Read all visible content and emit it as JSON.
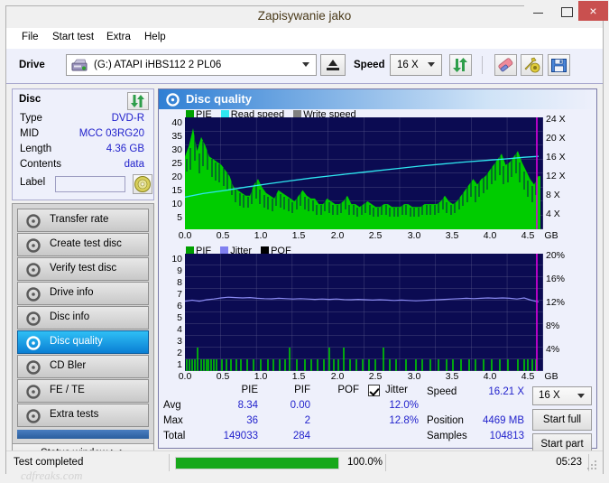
{
  "window": {
    "title": "Zapisywanie jako",
    "buttons": {
      "minimize": "minimize-icon",
      "maximize": "maximize-icon",
      "close": "×"
    }
  },
  "menu": {
    "items": [
      "File",
      "Start test",
      "Extra",
      "Help"
    ]
  },
  "toolbar": {
    "drive_label": "Drive",
    "drive_value": "(G:)  ATAPI iHBS112  2 PL06",
    "eject_title": "eject",
    "speed_label": "Speed",
    "speed_value": "16 X",
    "icons": [
      "refresh-icon",
      "eraser-icon",
      "tools-icon",
      "save-icon"
    ]
  },
  "disc": {
    "header": "Disc",
    "rows": [
      {
        "key": "Type",
        "value": "DVD-R"
      },
      {
        "key": "MID",
        "value": "MCC 03RG20"
      },
      {
        "key": "Length",
        "value": "4.36 GB"
      },
      {
        "key": "Contents",
        "value": "data"
      }
    ],
    "label_key": "Label",
    "label_value": ""
  },
  "nav": {
    "items": [
      "Transfer rate",
      "Create test disc",
      "Verify test disc",
      "Drive info",
      "Disc info",
      "Disc quality",
      "CD Bler",
      "FE / TE",
      "Extra tests"
    ],
    "selected_index": 5,
    "status_window": "Status window > >"
  },
  "main": {
    "title": "Disc quality"
  },
  "chart_data": [
    {
      "type": "area",
      "name": "pie-chart",
      "title": "Disc quality",
      "legend": [
        {
          "label": "PIE",
          "color": "#00a000"
        },
        {
          "label": "Read speed",
          "color": "#2ee6f0"
        },
        {
          "label": "Write speed",
          "color": "#808080"
        }
      ],
      "legend_position": "top-left",
      "grid": true,
      "xlabel": "GB",
      "xticks": [
        "0.0",
        "0.5",
        "1.0",
        "1.5",
        "2.0",
        "2.5",
        "3.0",
        "3.5",
        "4.0",
        "4.5"
      ],
      "xlim": [
        0,
        4.7
      ],
      "ylabel_left": "PIE",
      "yticks_left": [
        "40",
        "35",
        "30",
        "25",
        "20",
        "15",
        "10",
        "5"
      ],
      "ylim_left": [
        0,
        40
      ],
      "ylabel_right": "Speed",
      "yticks_right": [
        "24 X",
        "20 X",
        "16 X",
        "12 X",
        "8 X",
        "4 X"
      ],
      "ylim_right": [
        0,
        24
      ],
      "series": [
        {
          "name": "PIE",
          "color": "#00cc00",
          "x": [
            0.0,
            0.05,
            0.1,
            0.15,
            0.2,
            0.25,
            0.3,
            0.35,
            0.4,
            0.45,
            0.5,
            0.55,
            0.6,
            0.65,
            0.7,
            0.75,
            0.8,
            0.85,
            0.9,
            0.95,
            1.0,
            1.05,
            1.1,
            1.15,
            1.2,
            1.25,
            1.3,
            1.35,
            1.4,
            1.45,
            1.5,
            1.55,
            1.6,
            1.65,
            1.7,
            1.75,
            1.8,
            1.85,
            1.9,
            1.95,
            2.0,
            2.05,
            2.1,
            2.15,
            2.2,
            2.25,
            2.3,
            2.35,
            2.4,
            2.45,
            2.5,
            2.55,
            2.6,
            2.65,
            2.7,
            2.75,
            2.8,
            2.85,
            2.9,
            2.95,
            3.0,
            3.05,
            3.1,
            3.15,
            3.2,
            3.25,
            3.3,
            3.35,
            3.4,
            3.45,
            3.5,
            3.55,
            3.6,
            3.65,
            3.7,
            3.75,
            3.8,
            3.85,
            3.9,
            3.95,
            4.0,
            4.05,
            4.1,
            4.15,
            4.2,
            4.25,
            4.3,
            4.35,
            4.4
          ],
          "values": [
            26,
            30,
            36,
            28,
            33,
            30,
            26,
            25,
            24,
            23,
            21,
            19,
            15,
            14,
            13,
            12,
            12,
            16,
            18,
            15,
            13,
            12,
            11,
            14,
            13,
            12,
            11,
            10,
            11,
            13,
            11,
            10,
            10,
            9,
            9,
            11,
            10,
            9,
            9,
            10,
            11,
            9,
            9,
            8,
            9,
            10,
            9,
            8,
            8,
            9,
            9,
            8,
            8,
            8,
            9,
            9,
            8,
            8,
            8,
            9,
            9,
            9,
            9,
            10,
            11,
            10,
            9,
            10,
            11,
            12,
            13,
            14,
            13,
            14,
            15,
            16,
            17,
            18,
            19,
            21,
            20,
            22,
            23,
            24,
            22,
            20,
            18,
            17,
            19
          ]
        },
        {
          "name": "Read speed",
          "color": "#2ee6f0",
          "x": [
            0.0,
            0.5,
            1.0,
            1.5,
            2.0,
            2.5,
            3.0,
            3.5,
            4.0,
            4.45
          ],
          "values": [
            6.9,
            8.4,
            9.6,
            10.8,
            11.8,
            12.9,
            13.9,
            14.9,
            15.7,
            16.2
          ],
          "axis": "right",
          "unit": "X"
        }
      ],
      "marker_line": {
        "x": 4.45,
        "color": "#e000e0"
      }
    },
    {
      "type": "area",
      "name": "pif-chart",
      "legend": [
        {
          "label": "PIF",
          "color": "#00a000"
        },
        {
          "label": "Jitter",
          "color": "#8080f0"
        },
        {
          "label": "POF",
          "color": "#000000"
        }
      ],
      "legend_position": "top-left",
      "grid": true,
      "xlabel": "GB",
      "xticks": [
        "0.0",
        "0.5",
        "1.0",
        "1.5",
        "2.0",
        "2.5",
        "3.0",
        "3.5",
        "4.0",
        "4.5"
      ],
      "xlim": [
        0,
        4.7
      ],
      "ylabel_left": "PIF",
      "yticks_left": [
        "10",
        "9",
        "8",
        "7",
        "6",
        "5",
        "4",
        "3",
        "2",
        "1"
      ],
      "ylim_left": [
        0,
        10
      ],
      "ylabel_right": "Jitter",
      "yticks_right": [
        "20%",
        "16%",
        "12%",
        "8%",
        "4%"
      ],
      "ylim_right": [
        0,
        20
      ],
      "series": [
        {
          "name": "PIF",
          "color": "#00cc00",
          "note": "sparse spikes of height 1 with occasional 2",
          "spikes": [
            {
              "x": 0.02,
              "v": 1
            },
            {
              "x": 0.05,
              "v": 1
            },
            {
              "x": 0.09,
              "v": 1
            },
            {
              "x": 0.13,
              "v": 1
            },
            {
              "x": 0.17,
              "v": 2
            },
            {
              "x": 0.21,
              "v": 1
            },
            {
              "x": 0.24,
              "v": 1
            },
            {
              "x": 0.27,
              "v": 1
            },
            {
              "x": 0.3,
              "v": 1
            },
            {
              "x": 0.33,
              "v": 1
            },
            {
              "x": 0.36,
              "v": 1
            },
            {
              "x": 0.4,
              "v": 1
            },
            {
              "x": 0.46,
              "v": 1
            },
            {
              "x": 0.52,
              "v": 1
            },
            {
              "x": 0.58,
              "v": 1
            },
            {
              "x": 0.64,
              "v": 1
            },
            {
              "x": 0.7,
              "v": 1
            },
            {
              "x": 0.78,
              "v": 1
            },
            {
              "x": 0.86,
              "v": 1
            },
            {
              "x": 0.95,
              "v": 1
            },
            {
              "x": 1.04,
              "v": 1
            },
            {
              "x": 1.1,
              "v": 1
            },
            {
              "x": 1.18,
              "v": 1
            },
            {
              "x": 1.25,
              "v": 1
            },
            {
              "x": 1.31,
              "v": 2
            },
            {
              "x": 1.4,
              "v": 1
            },
            {
              "x": 1.5,
              "v": 1
            },
            {
              "x": 1.58,
              "v": 1
            },
            {
              "x": 1.66,
              "v": 1
            },
            {
              "x": 1.74,
              "v": 1
            },
            {
              "x": 1.8,
              "v": 2
            },
            {
              "x": 1.86,
              "v": 1
            },
            {
              "x": 1.92,
              "v": 1
            },
            {
              "x": 1.98,
              "v": 2
            },
            {
              "x": 2.06,
              "v": 1
            },
            {
              "x": 2.14,
              "v": 1
            },
            {
              "x": 2.22,
              "v": 1
            },
            {
              "x": 2.3,
              "v": 1
            },
            {
              "x": 2.38,
              "v": 1
            },
            {
              "x": 2.48,
              "v": 2
            },
            {
              "x": 2.56,
              "v": 1
            },
            {
              "x": 2.64,
              "v": 1
            },
            {
              "x": 2.76,
              "v": 1
            },
            {
              "x": 2.88,
              "v": 1
            },
            {
              "x": 2.96,
              "v": 1
            },
            {
              "x": 3.06,
              "v": 1
            },
            {
              "x": 3.16,
              "v": 1
            },
            {
              "x": 3.26,
              "v": 1
            },
            {
              "x": 3.34,
              "v": 1
            },
            {
              "x": 3.44,
              "v": 1
            },
            {
              "x": 3.54,
              "v": 1
            },
            {
              "x": 3.62,
              "v": 1
            },
            {
              "x": 3.72,
              "v": 1
            },
            {
              "x": 3.82,
              "v": 1
            },
            {
              "x": 3.92,
              "v": 1
            },
            {
              "x": 4.02,
              "v": 1
            },
            {
              "x": 4.12,
              "v": 1
            },
            {
              "x": 4.2,
              "v": 1
            },
            {
              "x": 4.26,
              "v": 1
            },
            {
              "x": 4.32,
              "v": 1
            },
            {
              "x": 4.38,
              "v": 1
            }
          ]
        },
        {
          "name": "Jitter",
          "color": "#8080f0",
          "axis": "right",
          "unit": "%",
          "x": [
            0.0,
            0.2,
            0.4,
            0.6,
            0.8,
            1.0,
            1.2,
            1.4,
            1.6,
            1.8,
            2.0,
            2.2,
            2.4,
            2.6,
            2.8,
            3.0,
            3.2,
            3.4,
            3.6,
            3.8,
            4.0,
            4.2,
            4.4
          ],
          "values": [
            11.9,
            12.1,
            12.5,
            12.4,
            12.3,
            12.3,
            12.2,
            12.2,
            12.2,
            12.1,
            12.1,
            12.0,
            12.0,
            11.9,
            11.9,
            12.0,
            12.1,
            12.2,
            12.2,
            12.2,
            12.1,
            12.0,
            11.8
          ]
        }
      ],
      "marker_line": {
        "x": 4.45,
        "color": "#e000e0"
      }
    }
  ],
  "stats": {
    "columns": [
      "PIE",
      "PIF",
      "POF",
      "Jitter"
    ],
    "jitter_checked": true,
    "rows": [
      {
        "label": "Avg",
        "pie": "8.34",
        "pif": "0.00",
        "pof": "",
        "jitter": "12.0%"
      },
      {
        "label": "Max",
        "pie": "36",
        "pif": "2",
        "pof": "",
        "jitter": "12.8%"
      },
      {
        "label": "Total",
        "pie": "149033",
        "pif": "284",
        "pof": "",
        "jitter": ""
      }
    ],
    "info": [
      {
        "label": "Speed",
        "value": "16.21 X"
      },
      {
        "label": "Position",
        "value": "4469 MB"
      },
      {
        "label": "Samples",
        "value": "104813"
      }
    ],
    "speed_select": "16 X",
    "start_full": "Start full",
    "start_part": "Start part"
  },
  "statusbar": {
    "message": "Test completed",
    "progress_percent": "100.0%",
    "progress_value": 100,
    "elapsed": "05:23"
  },
  "watermark": "cdfreaks.com"
}
